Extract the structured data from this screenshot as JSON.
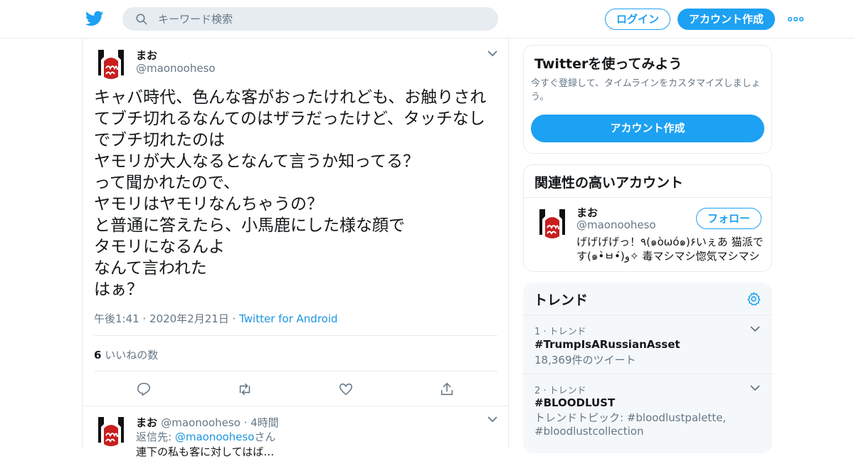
{
  "header": {
    "search_placeholder": "キーワード検索",
    "login_label": "ログイン",
    "signup_label": "アカウント作成",
    "accent_color": "#1da1f2"
  },
  "tweet": {
    "name": "まお",
    "handle": "@maonooheso",
    "text": "キャバ時代、色んな客がおったけれども、お触りされてブチ切れるなんてのはザラだったけど、タッチなしでブチ切れたのは\nヤモリが大人なるとなんて言うか知ってる？\nって聞かれたので、\nヤモリはヤモリなんちゃうの？\nと普通に答えたら、小馬鹿にした様な顔で\nタモリになるんよ\nなんて言われた\nはぁ？",
    "time": "午後1:41 · 2020年2月21日 · ",
    "source": "Twitter for Android",
    "likes_count": "6",
    "likes_label": " いいねの数"
  },
  "reply": {
    "name": "まお",
    "handle": "@maonooheso",
    "time": " · 4時間",
    "reply_prefix": "返信先: ",
    "reply_link": "@maonooheso",
    "reply_suffix": "さん",
    "text_partial": "連下の私も客に対してはば…"
  },
  "sidebar": {
    "signup_card": {
      "title": "Twitterを使ってみよう",
      "subtitle": "今すぐ登録して、タイムラインをカスタマイズしましょう。",
      "button": "アカウント作成"
    },
    "related_card": {
      "title": "関連性の高いアカウント",
      "name": "まお",
      "handle": "@maonooheso",
      "follow_button": "フォロー",
      "bio": "げげげげっ！٩(๑òωó๑)۶いぇあ 猫派です(๑•̀ㅂ•́)و✧ 毒マシマシ惚気マシマシ"
    },
    "trends_card": {
      "title": "トレンド",
      "items": [
        {
          "meta": "1 · トレンド",
          "name": "#TrumpIsARussianAsset",
          "sub": "18,369件のツイート"
        },
        {
          "meta": "2 · トレンド",
          "name": "#BLOODLUST",
          "sub": "トレンドトピック: #bloodlustpalette, #bloodlustcollection"
        }
      ]
    }
  }
}
